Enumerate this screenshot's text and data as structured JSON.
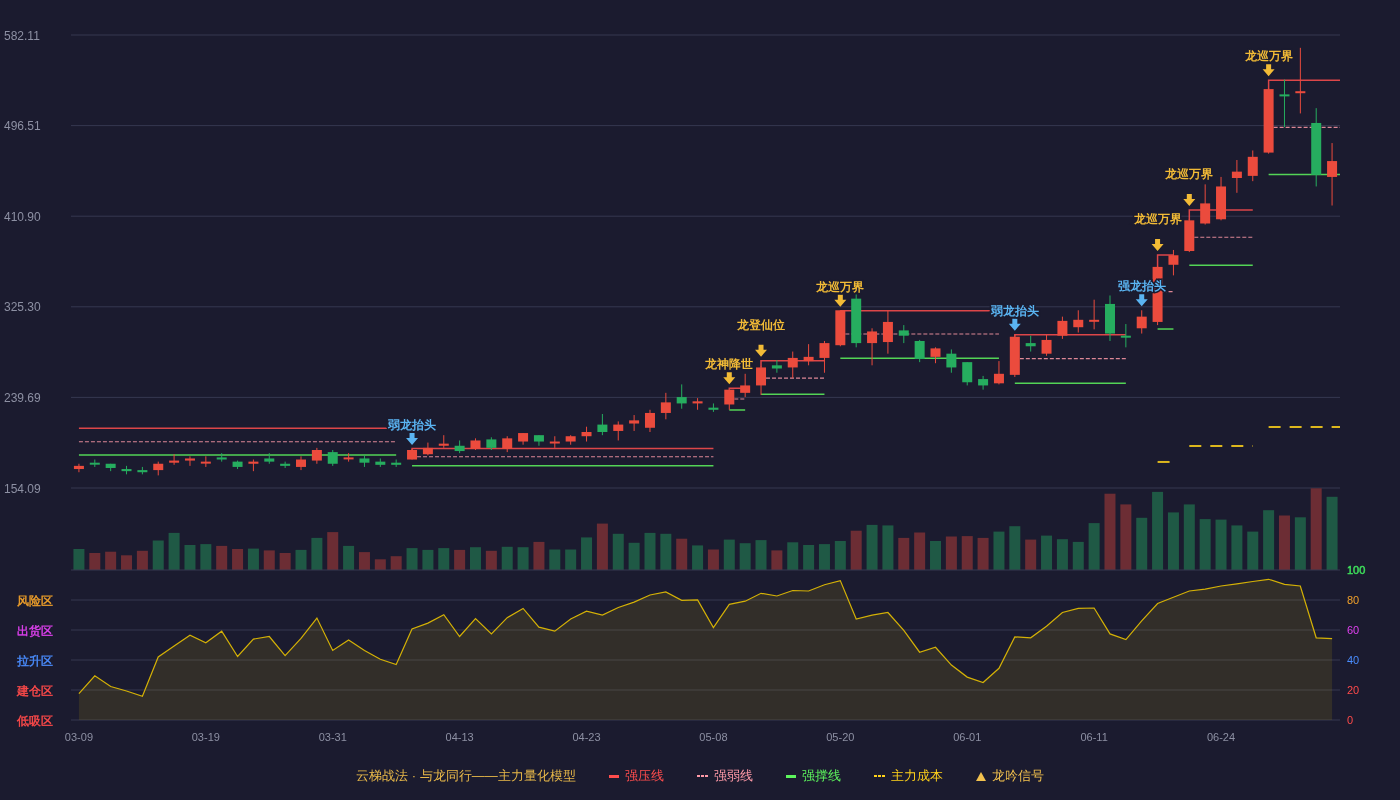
{
  "price_panel": {
    "chart_data": {
      "type": "candlestick",
      "grid": true,
      "categories": [
        null,
        null,
        null,
        null,
        null,
        null,
        null,
        null,
        null,
        null,
        null,
        null,
        null,
        null,
        null,
        null,
        null,
        null,
        null,
        null,
        null,
        null,
        null,
        null,
        null,
        null,
        null,
        null,
        null,
        null,
        null,
        null,
        null,
        null,
        null,
        null,
        null,
        null,
        null,
        null,
        null,
        null,
        null,
        null,
        null,
        null,
        null,
        null,
        null,
        null,
        null,
        null,
        null,
        null,
        null,
        null,
        null,
        null,
        null,
        null,
        null,
        null,
        null,
        null,
        null,
        null,
        null,
        null,
        null,
        null,
        null,
        null,
        null,
        null,
        null,
        null,
        null,
        null,
        null,
        null
      ],
      "ylim": [
        154.09,
        582.11
      ],
      "yticks": [
        {
          "value": 154.09,
          "label": "154.09"
        },
        {
          "value": 239.69,
          "label": "239.69"
        },
        {
          "value": 325.3,
          "label": "325.30"
        },
        {
          "value": 410.9,
          "label": "410.90"
        },
        {
          "value": 496.51,
          "label": "496.51"
        },
        {
          "value": 582.11,
          "label": "582.11"
        }
      ],
      "ohlc": [
        [
          172,
          177,
          169,
          175
        ],
        [
          178,
          181,
          174,
          177
        ],
        [
          177,
          177,
          170,
          173
        ],
        [
          172,
          175,
          167,
          170
        ],
        [
          171,
          174,
          167,
          169
        ],
        [
          171,
          179,
          166,
          177
        ],
        [
          178,
          186,
          176,
          180
        ],
        [
          180,
          184,
          175,
          182
        ],
        [
          178,
          184,
          174,
          179
        ],
        [
          183,
          187,
          179,
          181
        ],
        [
          179,
          180,
          172,
          174
        ],
        [
          177,
          181,
          170,
          179
        ],
        [
          182,
          187,
          177,
          179
        ],
        [
          177,
          179,
          173,
          175
        ],
        [
          174,
          184,
          171,
          181
        ],
        [
          180,
          192,
          177,
          190
        ],
        [
          188,
          190,
          175,
          177
        ],
        [
          182,
          187,
          179,
          183
        ],
        [
          182,
          185,
          174,
          178
        ],
        [
          179,
          182,
          174,
          176
        ],
        [
          178,
          181,
          174,
          176
        ],
        [
          181,
          191,
          181,
          190
        ],
        [
          186,
          197,
          185,
          192
        ],
        [
          194,
          204,
          192,
          196
        ],
        [
          194,
          199,
          187,
          189
        ],
        [
          191,
          201,
          190,
          199
        ],
        [
          200,
          202,
          190,
          192
        ],
        [
          191,
          203,
          188,
          201
        ],
        [
          198,
          206,
          195,
          206
        ],
        [
          204,
          204,
          194,
          198
        ],
        [
          197,
          203,
          192,
          198
        ],
        [
          198,
          204,
          195,
          203
        ],
        [
          203,
          212,
          198,
          207
        ],
        [
          214,
          224,
          204,
          207
        ],
        [
          208,
          217,
          199,
          214
        ],
        [
          215,
          223,
          208,
          218
        ],
        [
          211,
          228,
          207,
          225
        ],
        [
          225,
          244,
          219,
          235
        ],
        [
          240,
          252,
          229,
          234
        ],
        [
          234,
          239,
          228,
          236
        ],
        [
          230,
          234,
          226,
          228
        ],
        [
          233,
          247,
          228,
          247
        ],
        [
          244,
          262,
          240,
          251
        ],
        [
          251,
          269,
          242,
          268
        ],
        [
          270,
          275,
          263,
          267
        ],
        [
          268,
          283,
          258,
          277
        ],
        [
          274,
          290,
          270,
          278
        ],
        [
          277,
          293,
          263,
          291
        ],
        [
          289,
          322,
          288,
          322
        ],
        [
          333,
          337,
          287,
          291
        ],
        [
          291,
          305,
          270,
          302
        ],
        [
          292,
          322,
          281,
          311
        ],
        [
          303,
          308,
          291,
          298
        ],
        [
          293,
          294,
          273,
          276
        ],
        [
          278,
          287,
          272,
          286
        ],
        [
          281,
          285,
          263,
          268
        ],
        [
          273,
          273,
          251,
          254
        ],
        [
          257,
          260,
          247,
          251
        ],
        [
          253,
          274,
          252,
          262
        ],
        [
          261,
          299,
          259,
          297
        ],
        [
          291,
          298,
          283,
          288
        ],
        [
          281,
          299,
          279,
          294
        ],
        [
          298,
          316,
          295,
          312
        ],
        [
          306,
          322,
          301,
          313
        ],
        [
          312,
          332,
          304,
          313
        ],
        [
          328,
          336,
          293,
          300
        ],
        [
          298,
          309,
          287,
          297
        ],
        [
          305,
          322,
          300,
          316
        ],
        [
          311,
          364,
          308,
          363
        ],
        [
          365,
          379,
          355,
          374
        ],
        [
          378,
          408,
          377,
          407
        ],
        [
          404,
          441,
          403,
          423
        ],
        [
          408,
          448,
          407,
          439
        ],
        [
          447,
          464,
          433,
          453
        ],
        [
          449,
          473,
          444,
          467
        ],
        [
          471,
          532,
          470,
          531
        ],
        [
          526,
          540,
          495,
          525
        ],
        [
          528,
          570,
          508,
          529
        ],
        [
          499,
          513,
          439,
          450
        ],
        [
          448,
          480,
          421,
          463
        ]
      ],
      "annotations": [
        "弱龙抬头",
        "龙神降世",
        "龙登仙位",
        "龙巡万界",
        "弱龙抬头",
        "强龙抬头",
        "龙巡万界",
        "龙巡万界",
        "龙巡万界"
      ]
    },
    "signal_markers": [
      {
        "color": "#5ab4f2"
      },
      {
        "color": "#f2bb36"
      },
      {
        "color": "#f2bb36"
      },
      {
        "color": "#f2bb36"
      },
      {
        "color": "#5ab4f2"
      },
      {
        "color": "#5ab4f2"
      },
      {
        "color": "#f2bb36"
      },
      {
        "color": "#f2bb36"
      },
      {
        "color": "#f2bb36"
      }
    ]
  },
  "indicator_panel": {
    "bands": [
      {
        "color": "#3ddc5a"
      },
      {
        "label": "风险区",
        "color": "#f0a02a"
      },
      {
        "label": "出货区",
        "color": "#e040f0"
      },
      {
        "label": "拉升区",
        "color": "#4a8dff"
      },
      {
        "label": "建仓区",
        "color": "#ff4a4a"
      },
      {
        "label": "低吸区",
        "color": "#ff4a4a"
      }
    ],
    "chart_data": {
      "type": "area",
      "grid": true,
      "ylim": [
        0,
        100
      ],
      "yticks": [
        100,
        80,
        60,
        40,
        20,
        0
      ],
      "categories": [
        "03-09",
        null,
        null,
        null,
        null,
        null,
        null,
        null,
        "03-19",
        null,
        null,
        null,
        null,
        null,
        null,
        null,
        "03-31",
        null,
        null,
        null,
        null,
        null,
        null,
        null,
        "04-13",
        null,
        null,
        null,
        null,
        null,
        null,
        null,
        "04-23",
        null,
        null,
        null,
        null,
        null,
        null,
        null,
        "05-08",
        null,
        null,
        null,
        null,
        null,
        null,
        null,
        "05-20",
        null,
        null,
        null,
        null,
        null,
        null,
        null,
        "06-01",
        null,
        null,
        null,
        null,
        null,
        null,
        null,
        "06-11",
        null,
        null,
        null,
        null,
        null,
        null,
        null,
        "06-24",
        null,
        null,
        null,
        null,
        null,
        null,
        null
      ],
      "series": [
        {
          "color": "#d4b106",
          "values": [
            17.6,
            29.5,
            22.3,
            19.3,
            15.8,
            42.0,
            49.4,
            56.5,
            51.5,
            59.2,
            42.3,
            53.9,
            55.7,
            42.9,
            54.5,
            67.9,
            46.4,
            53.3,
            46.4,
            40.5,
            36.9,
            60.7,
            64.6,
            70.2,
            55.7,
            67.6,
            57.4,
            68.2,
            74.4,
            61.9,
            59.2,
            67.3,
            72.6,
            69.9,
            75.0,
            78.6,
            83.3,
            85.4,
            79.8,
            80.1,
            61.6,
            77.1,
            79.2,
            84.5,
            82.7,
            86.3,
            86.0,
            90.2,
            92.9,
            67.3,
            69.9,
            71.7,
            59.8,
            45.2,
            48.5,
            36.6,
            28.6,
            25.0,
            34.5,
            55.4,
            54.8,
            62.5,
            71.7,
            74.4,
            74.7,
            57.4,
            53.6,
            66.1,
            77.7,
            81.8,
            86.0,
            87.2,
            89.3,
            90.8,
            92.3,
            93.8,
            90.5,
            89.3,
            54.8,
            54.2
          ]
        }
      ]
    }
  },
  "legend": {
    "title": "云梯战法 · 与龙同行——主力量化模型",
    "items": [
      {
        "label": "强压线",
        "kind": "solid",
        "color": "#ff4d4d"
      },
      {
        "label": "强弱线",
        "kind": "dashed",
        "color": "#ff9aa8"
      },
      {
        "label": "强撑线",
        "kind": "solid",
        "color": "#5df55d"
      },
      {
        "label": "主力成本",
        "kind": "dashed",
        "color": "#ffd21a"
      },
      {
        "label": "龙吟信号",
        "kind": "triangle",
        "color": "#f2c14e"
      }
    ]
  }
}
